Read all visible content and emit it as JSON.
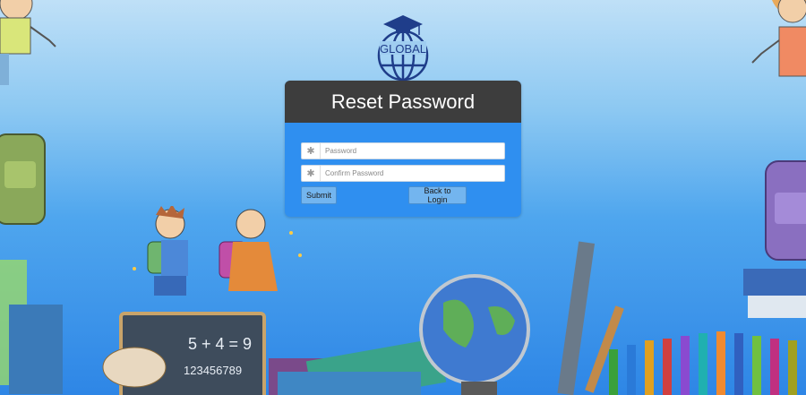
{
  "logo": {
    "text": "GLOBAL"
  },
  "panel": {
    "title": "Reset Password",
    "password_placeholder": "Password",
    "confirm_placeholder": "Confirm Password",
    "submit_label": "Submit",
    "back_label": "Back to Login"
  },
  "chalkboard": {
    "line1": "5 + 4 = 9",
    "line2": "123456789"
  },
  "icons": {
    "field_icon": "asterisk-icon"
  },
  "colors": {
    "header": "#3d3d3d",
    "panel": "#2f8ff0",
    "button": "#73b5ef"
  }
}
